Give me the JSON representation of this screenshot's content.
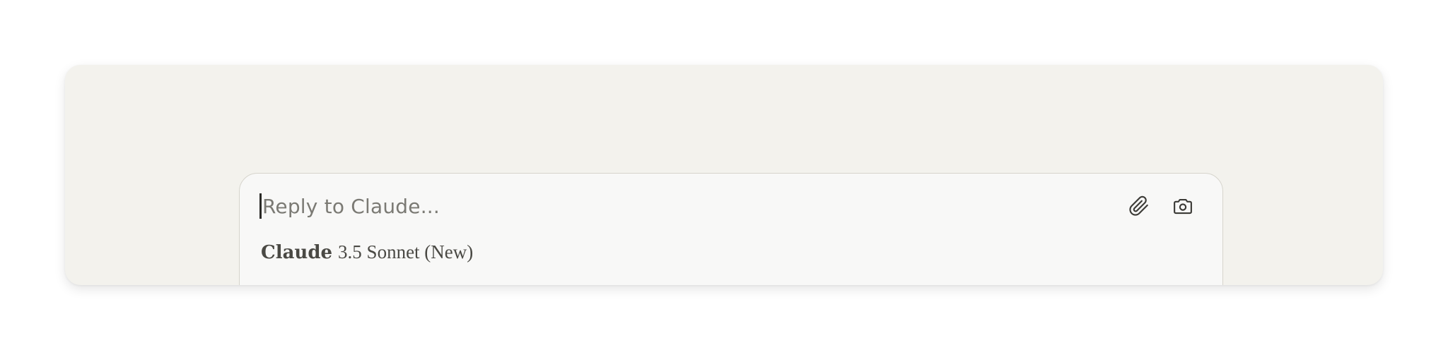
{
  "composer": {
    "placeholder": "Reply to Claude..."
  },
  "actions": {
    "attach_icon": "paperclip-icon",
    "screenshot_icon": "camera-icon"
  },
  "model": {
    "brand": "Claude",
    "version": "3.5 Sonnet (New)"
  },
  "colors": {
    "card_background": "#f3f2ed",
    "composer_background": "#f8f8f7",
    "text": "#4a4944",
    "placeholder": "#7b7a74"
  }
}
